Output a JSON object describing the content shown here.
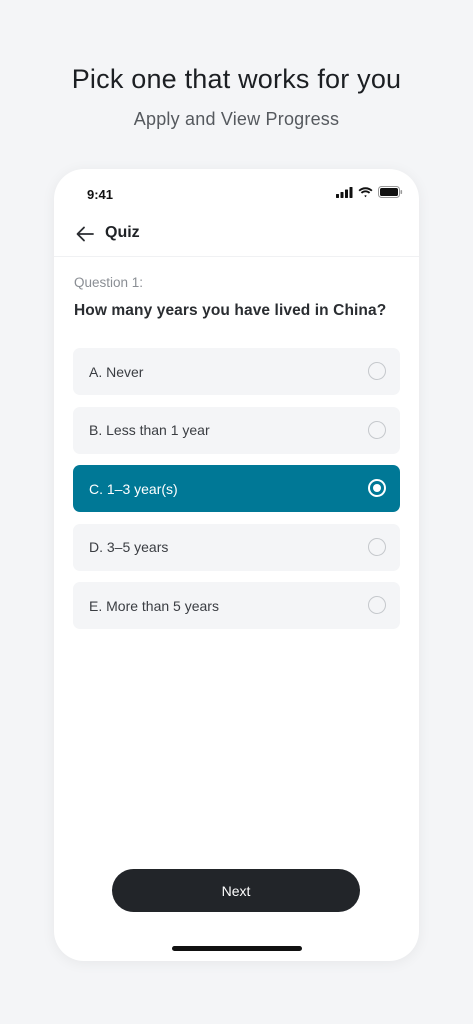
{
  "hero": {
    "title": "Pick one that works for you",
    "subtitle": "Apply and View Progress"
  },
  "status_bar": {
    "time": "9:41",
    "icons": [
      "cellular-signal-icon",
      "wifi-icon",
      "battery-icon"
    ]
  },
  "nav": {
    "title": "Quiz",
    "back_icon": "arrow-left-icon"
  },
  "question": {
    "number_label": "Question 1:",
    "text": "How many years you have lived in China?"
  },
  "options": [
    {
      "label": "A.  Never",
      "selected": false
    },
    {
      "label": "B.  Less than 1 year",
      "selected": false
    },
    {
      "label": "C.  1–3 year(s)",
      "selected": true
    },
    {
      "label": "D.  3–5 years",
      "selected": false
    },
    {
      "label": "E.  More than 5 years",
      "selected": false
    }
  ],
  "footer": {
    "next_label": "Next"
  },
  "colors": {
    "accent": "#007896",
    "button_dark": "#222529",
    "option_bg": "#f4f5f7",
    "page_bg": "#f4f5f7"
  }
}
